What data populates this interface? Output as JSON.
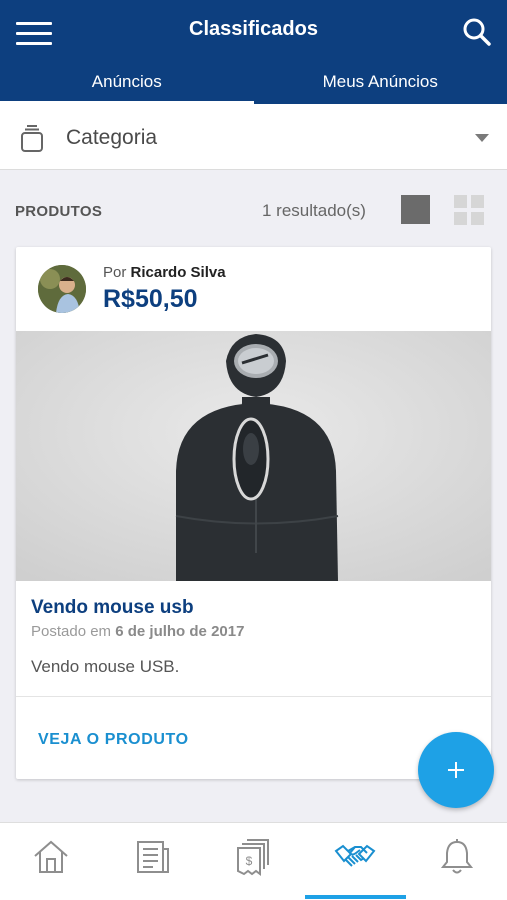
{
  "header": {
    "title": "Classificados",
    "tabs": [
      {
        "label": "Anúncios",
        "active": true
      },
      {
        "label": "Meus Anúncios",
        "active": false
      }
    ],
    "background": "#0d3f7f"
  },
  "category": {
    "label": "Categoria"
  },
  "results": {
    "section_label": "PRODUTOS",
    "count_text": "1 resultado(s)",
    "view_mode": "list"
  },
  "listing": {
    "by_prefix": "Por",
    "seller": "Ricardo Silva",
    "price": "R$50,50",
    "title": "Vendo mouse usb",
    "posted_prefix": "Postado em",
    "posted_date": "6 de julho de 2017",
    "description": "Vendo mouse USB.",
    "cta": "VEJA O PRODUTO"
  },
  "bottom_nav": {
    "items": [
      "home-icon",
      "news-icon",
      "receipts-icon",
      "handshake-icon",
      "bell-icon"
    ],
    "active_index": 3
  },
  "colors": {
    "primary": "#0d3f7f",
    "accent": "#1ea1e6",
    "link": "#1a8fd0"
  }
}
